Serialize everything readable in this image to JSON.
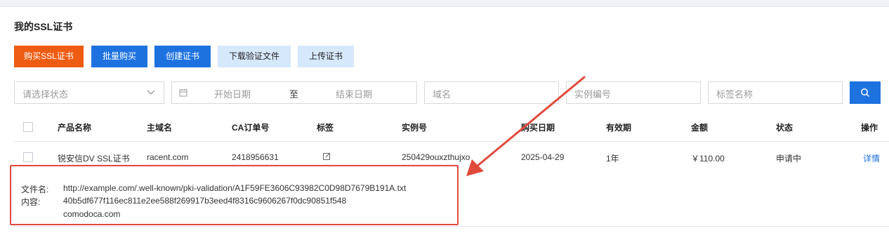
{
  "page_title": "我的SSL证书",
  "toolbar": {
    "buy_ssl": "购买SSL证书",
    "bulk_buy": "批量购买",
    "create_cert": "创建证书",
    "download_verify": "下载验证文件",
    "upload_cert": "上传证书"
  },
  "filters": {
    "status_placeholder": "请选择状态",
    "start_date": "开始日期",
    "date_sep": "至",
    "end_date": "结束日期",
    "domain_placeholder": "域名",
    "instance_placeholder": "实例编号",
    "tag_placeholder": "标签名称"
  },
  "table": {
    "headers": [
      "产品名称",
      "主域名",
      "CA订单号",
      "标签",
      "实例号",
      "购买日期",
      "有效期",
      "金额",
      "状态",
      "操作"
    ],
    "row": {
      "product": "锐安信DV SSL证书",
      "domain": "racent.com",
      "ca_order": "2418956631",
      "instance": "250429ouxzthujxo",
      "date": "2025-04-29",
      "validity": "1年",
      "amount": "￥110.00",
      "status": "申请中",
      "action": "详情"
    }
  },
  "popup": {
    "file_label": "文件名:",
    "file_value": "http://example.com/.well-known/pki-validation/A1F59FE3606C93982C0D98D7679B191A.txt",
    "content_label": "内容:",
    "content_line1": "40b5df677f116ec811e2ee588f269917b3eed4f8316c9606267f0dc90851f548",
    "content_line2": "comodoca.com"
  },
  "colors": {
    "orange": "#ee5c14",
    "blue": "#1e72e0",
    "light_blue": "#d6e8fc",
    "annotation_red": "#e04a3c"
  }
}
